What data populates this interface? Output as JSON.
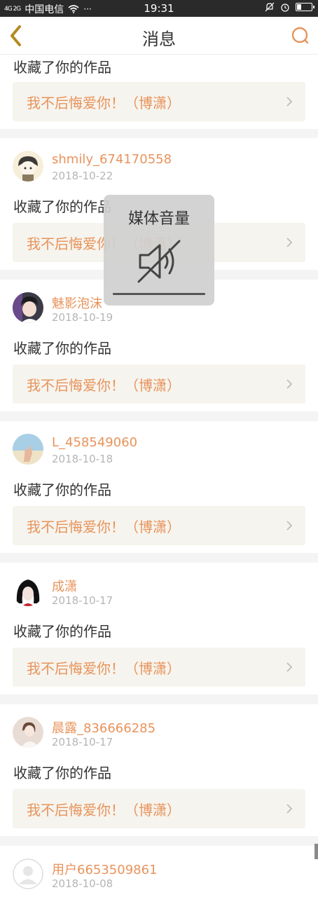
{
  "status_bar": {
    "signal": "4G 2G",
    "carrier": "中国电信",
    "more": "···",
    "time": "19:31"
  },
  "nav": {
    "title": "消息"
  },
  "feed": {
    "first_partial": {
      "action": "收藏了你的作品",
      "work_title": "我不后悔爱你！（博潇）"
    },
    "items": [
      {
        "username": "shmily_674170558",
        "date": "2018-10-22",
        "action": "收藏了你的作品",
        "work_title": "我不后悔爱你！（博潇）"
      },
      {
        "username": "魅影泡沫",
        "date": "2018-10-19",
        "action": "收藏了你的作品",
        "work_title": "我不后悔爱你！（博潇）"
      },
      {
        "username": "L_458549060",
        "date": "2018-10-18",
        "action": "收藏了你的作品",
        "work_title": "我不后悔爱你！（博潇）"
      },
      {
        "username": "成潇",
        "date": "2018-10-17",
        "action": "收藏了你的作品",
        "work_title": "我不后悔爱你！（博潇）"
      },
      {
        "username": "晨露_836666285",
        "date": "2018-10-17",
        "action": "收藏了你的作品",
        "work_title": "我不后悔爱你！（博潇）"
      },
      {
        "username": "用户6653509861",
        "date": "2018-10-08"
      }
    ]
  },
  "volume_overlay": {
    "title": "媒体音量",
    "icon": "speaker-muted-icon",
    "level": 0
  },
  "colors": {
    "accent": "#e8935b",
    "link_bg": "#f6f4ee",
    "date": "#b5b5b5",
    "divider": "#f4f4f4"
  }
}
